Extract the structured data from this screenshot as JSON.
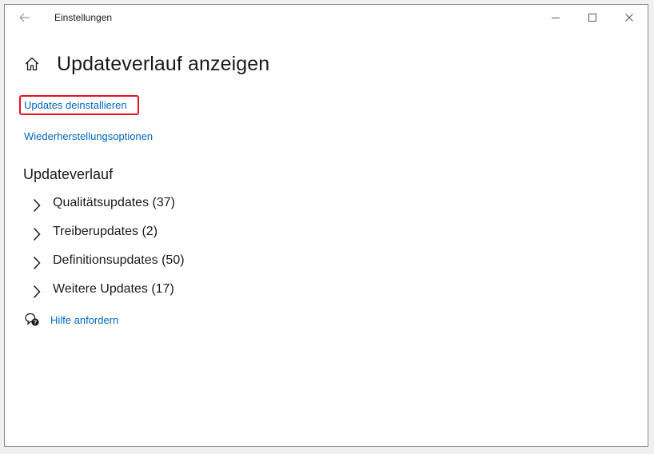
{
  "window": {
    "title": "Einstellungen"
  },
  "header": {
    "title": "Updateverlauf anzeigen"
  },
  "links": {
    "uninstall": "Updates deinstallieren",
    "recovery": "Wiederherstellungsoptionen"
  },
  "history": {
    "title": "Updateverlauf",
    "items": [
      {
        "label": "Qualitätsupdates (37)"
      },
      {
        "label": "Treiberupdates (2)"
      },
      {
        "label": "Definitionsupdates (50)"
      },
      {
        "label": "Weitere Updates (17)"
      }
    ]
  },
  "help": {
    "label": "Hilfe anfordern"
  },
  "colors": {
    "link": "#0067c0",
    "highlight_border": "#e81123",
    "text": "#1a1a1a"
  },
  "icons": {
    "back": "back-arrow-icon",
    "minimize": "minimize-icon",
    "maximize": "maximize-icon",
    "close": "close-icon",
    "home": "home-icon",
    "chevron": "chevron-right-icon",
    "help": "help-chat-icon"
  }
}
